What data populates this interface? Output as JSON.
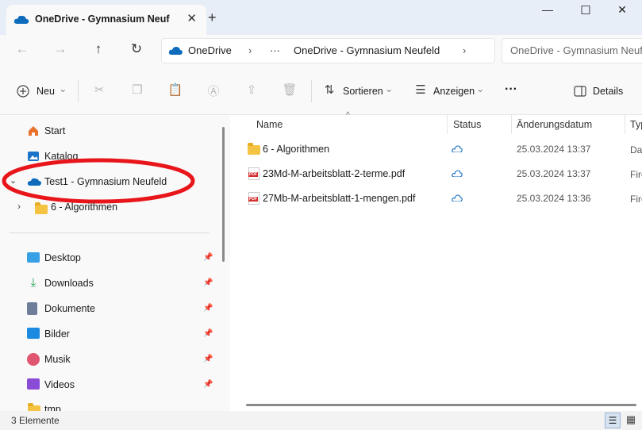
{
  "tab": {
    "title": "OneDrive - Gymnasium Neufeld",
    "close": "✕",
    "new": "+"
  },
  "window": {
    "minimize": "—",
    "maximize": "☐",
    "close": "✕"
  },
  "nav": {
    "back": "←",
    "forward": "→",
    "up": "↑",
    "refresh": "↻"
  },
  "breadcrumb": {
    "root": "OneDrive",
    "ellipsis": "···",
    "current": "OneDrive - Gymnasium Neufeld",
    "sep": "›"
  },
  "search": {
    "text": "OneDrive - Gymnasium Neufeld"
  },
  "toolbar": {
    "new_label": "Neu",
    "sort_label": "Sortieren",
    "view_label": "Anzeigen",
    "more": "···",
    "details_label": "Details",
    "caret": "⌄"
  },
  "sidebar": {
    "items": [
      {
        "label": "Start"
      },
      {
        "label": "Katalog"
      },
      {
        "label": "Test1 - Gymnasium Neufeld"
      },
      {
        "label": "6 - Algorithmen"
      }
    ],
    "quick": [
      {
        "label": "Desktop"
      },
      {
        "label": "Downloads"
      },
      {
        "label": "Dokumente"
      },
      {
        "label": "Bilder"
      },
      {
        "label": "Musik"
      },
      {
        "label": "Videos"
      },
      {
        "label": "tmp"
      }
    ]
  },
  "columns": {
    "name": "Name",
    "status": "Status",
    "date": "Änderungsdatum",
    "type": "Typ"
  },
  "files": [
    {
      "name": "6 - Algorithmen",
      "kind": "folder",
      "date": "25.03.2024 13:37",
      "type": "Dateiordner"
    },
    {
      "name": "23Md-M-arbeitsblatt-2-terme.pdf",
      "kind": "pdf",
      "date": "25.03.2024 13:37",
      "type": "Firefox PDF Document"
    },
    {
      "name": "27Mb-M-arbeitsblatt-1-mengen.pdf",
      "kind": "pdf",
      "date": "25.03.2024 13:36",
      "type": "Firefox PDF Document"
    }
  ],
  "status": {
    "count": "3 Elemente"
  },
  "colors": {
    "accent": "#0067c0",
    "annotation": "#e8161b",
    "onedrive": "#0f6cbd"
  }
}
